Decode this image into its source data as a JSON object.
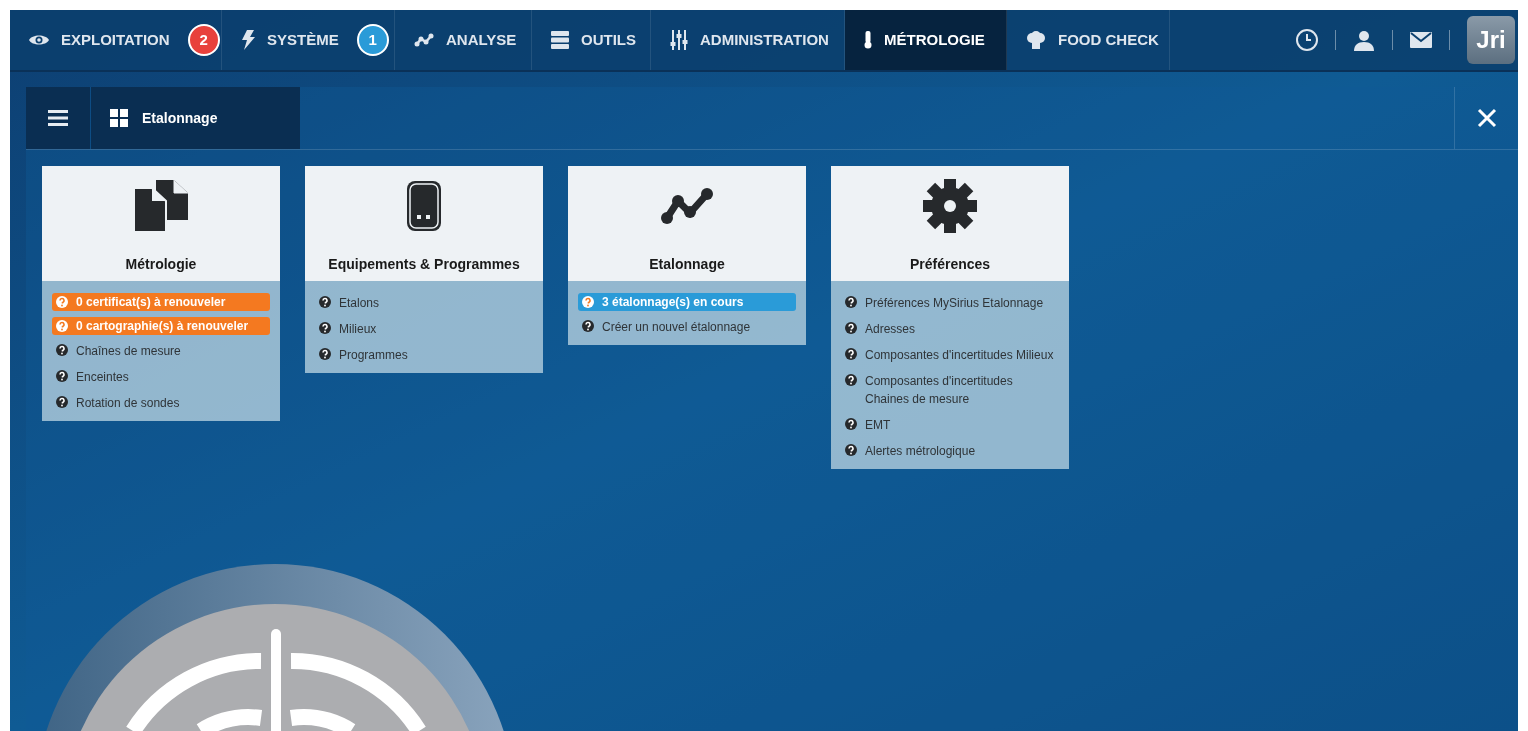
{
  "nav": {
    "tabs": [
      {
        "label": "EXPLOITATION",
        "selected": false,
        "badge": {
          "text": "2",
          "color": "#e8413c"
        }
      },
      {
        "label": "SYSTÈME",
        "selected": false,
        "badge": {
          "text": "1",
          "color": "#2a9bd8"
        }
      },
      {
        "label": "ANALYSE",
        "selected": false
      },
      {
        "label": "OUTILS",
        "selected": false
      },
      {
        "label": "ADMINISTRATION",
        "selected": false
      },
      {
        "label": "MÉTROLOGIE",
        "selected": true
      },
      {
        "label": "FOOD CHECK",
        "selected": false
      }
    ],
    "logo": "Jri"
  },
  "panel": {
    "title": "Etalonnage"
  },
  "cards": [
    {
      "title": "Métrologie",
      "items": [
        {
          "kind": "highlight",
          "color": "#f47920",
          "text": "0 certificat(s) à renouveler"
        },
        {
          "kind": "highlight",
          "color": "#f47920",
          "text": "0 cartographie(s) à renouveler"
        },
        {
          "kind": "link",
          "text": "Chaînes de mesure"
        },
        {
          "kind": "link",
          "text": "Enceintes"
        },
        {
          "kind": "link",
          "text": "Rotation de sondes"
        }
      ]
    },
    {
      "title": "Equipements & Programmes",
      "items": [
        {
          "kind": "link",
          "text": "Etalons"
        },
        {
          "kind": "link",
          "text": "Milieux"
        },
        {
          "kind": "link",
          "text": "Programmes"
        }
      ]
    },
    {
      "title": "Etalonnage",
      "items": [
        {
          "kind": "highlight",
          "color": "#2a9bd8",
          "text": "3 étalonnage(s) en cours"
        },
        {
          "kind": "link",
          "text": "Créer un nouvel étalonnage"
        }
      ]
    },
    {
      "title": "Préférences",
      "items": [
        {
          "kind": "link",
          "text": "Préférences MySirius Etalonnage"
        },
        {
          "kind": "link",
          "text": "Adresses"
        },
        {
          "kind": "link",
          "text": "Composantes d'incertitudes Milieux"
        },
        {
          "kind": "link",
          "text": "Composantes d'incertitudes Chaines de mesure"
        },
        {
          "kind": "link",
          "text": "EMT"
        },
        {
          "kind": "link",
          "text": "Alertes métrologique"
        }
      ]
    }
  ]
}
